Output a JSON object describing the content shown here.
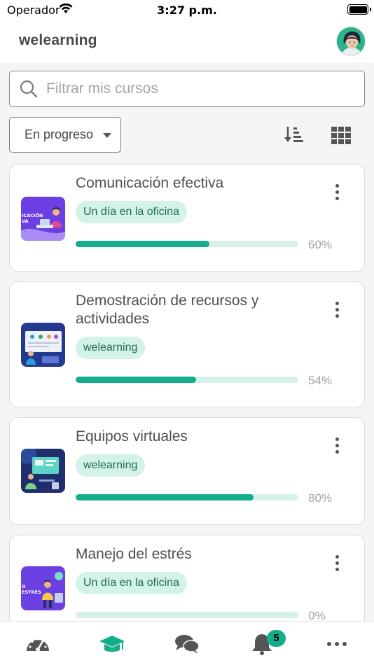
{
  "status_bar": {
    "carrier": "Operador",
    "time": "3:27 p.m."
  },
  "header": {
    "title": "welearning",
    "avatar_icon": "user-avatar-icon"
  },
  "search": {
    "placeholder": "Filtrar mis cursos",
    "value": "",
    "icon": "search-icon"
  },
  "filter": {
    "selected": "En progreso",
    "sort_icon": "sort-descending-icon",
    "view_icon": "grid-view-icon"
  },
  "colors": {
    "accent": "#15ae8a",
    "tag_bg": "#d3f2ea",
    "track_bg": "#d6f1ea"
  },
  "courses": [
    {
      "title": "Comunicación efectiva",
      "tag": "Un día en la oficina",
      "progress": 60,
      "progress_label": "60%"
    },
    {
      "title": "Demostración de recursos y actividades",
      "tag": "welearning",
      "progress": 54,
      "progress_label": "54%"
    },
    {
      "title": "Equipos virtuales",
      "tag": "welearning",
      "progress": 80,
      "progress_label": "80%"
    },
    {
      "title": "Manejo del estrés",
      "tag": "Un día en la oficina",
      "progress": 0,
      "progress_label": "0%"
    }
  ],
  "thumbnails": [
    {
      "text_1": "ICACIÓN",
      "text_2": "VA"
    },
    {},
    {},
    {
      "text_1": "O",
      "text_2": "ESTRÉS"
    }
  ],
  "tab_bar": {
    "tabs": [
      {
        "icon": "dashboard-gauge-icon",
        "active": false
      },
      {
        "icon": "graduation-cap-icon",
        "active": true
      },
      {
        "icon": "chat-bubbles-icon",
        "active": false
      },
      {
        "icon": "bell-icon",
        "active": false
      },
      {
        "icon": "more-dots-icon",
        "active": false
      }
    ],
    "notifications_badge": "5"
  }
}
